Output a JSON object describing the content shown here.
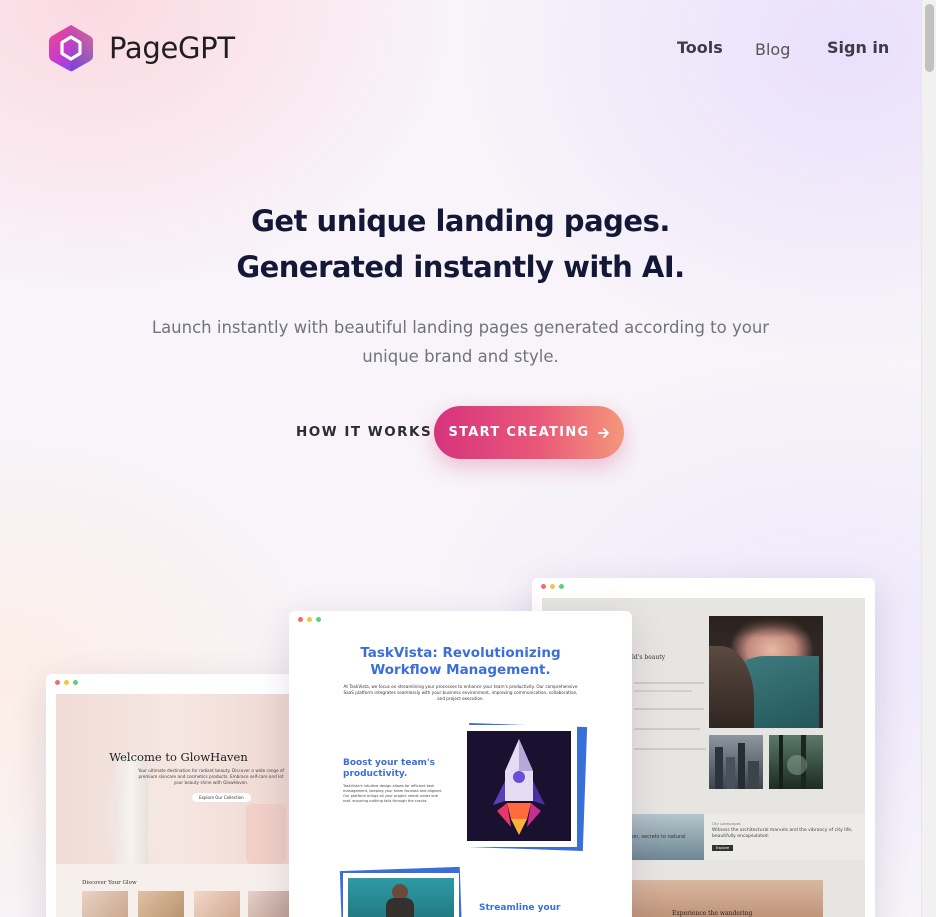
{
  "brand": {
    "name": "PageGPT",
    "logo_icon": "hexagon-logo-icon"
  },
  "nav": {
    "tools": "Tools",
    "blog": "Blog",
    "signin": "Sign in"
  },
  "hero": {
    "headline_1": "Get unique landing pages.",
    "headline_2": "Generated instantly with AI.",
    "subtitle": "Launch instantly with beautiful landing pages generated according to your unique brand and style.",
    "how_it_works": "HOW IT WORKS",
    "start_creating": "START CREATING",
    "arrow_icon": "arrow-right-icon"
  },
  "previews": {
    "glowhaven": {
      "title": "Welcome to GlowHaven",
      "text": "Your ultimate destination for radiant beauty. Discover a wide range of premium skincare and cosmetics products. Embrace self-care and let your beauty shine with GlowHaven.",
      "button": "Explore Our Collection",
      "section": "Discover Your Glow"
    },
    "taskvista": {
      "title_1": "TaskVista: Revolutionizing",
      "title_2": "Workflow Management.",
      "intro": "At TaskVista, we focus on streamlining your processes to enhance your team's productivity. Our comprehensive SaaS platform integrates seamlessly with your business environment, improving communication, collaboration, and project execution.",
      "feature_title": "Boost your team's productivity.",
      "feature_text": "TaskVista's intuitive design allows for efficient task management, keeping your team focused and aligned. Our platform brings all your project needs under one roof, ensuring nothing falls through the cracks.",
      "feature2_title": "Streamline your"
    },
    "travel": {
      "tagline": "ld's beauty",
      "caption_small": "City Landscapes",
      "caption_text": "Witness the architectural marvels and the vibrancy of city life, beautifully encapsulated.",
      "caption_button": "Explore",
      "left_caption": "on, secrets to natural",
      "bottom_text": "Experience the wandering"
    }
  },
  "colors": {
    "accent_start": "#d6337d",
    "accent_end": "#f4977a",
    "heading": "#131836",
    "taskvista_blue": "#3b6fd8"
  }
}
